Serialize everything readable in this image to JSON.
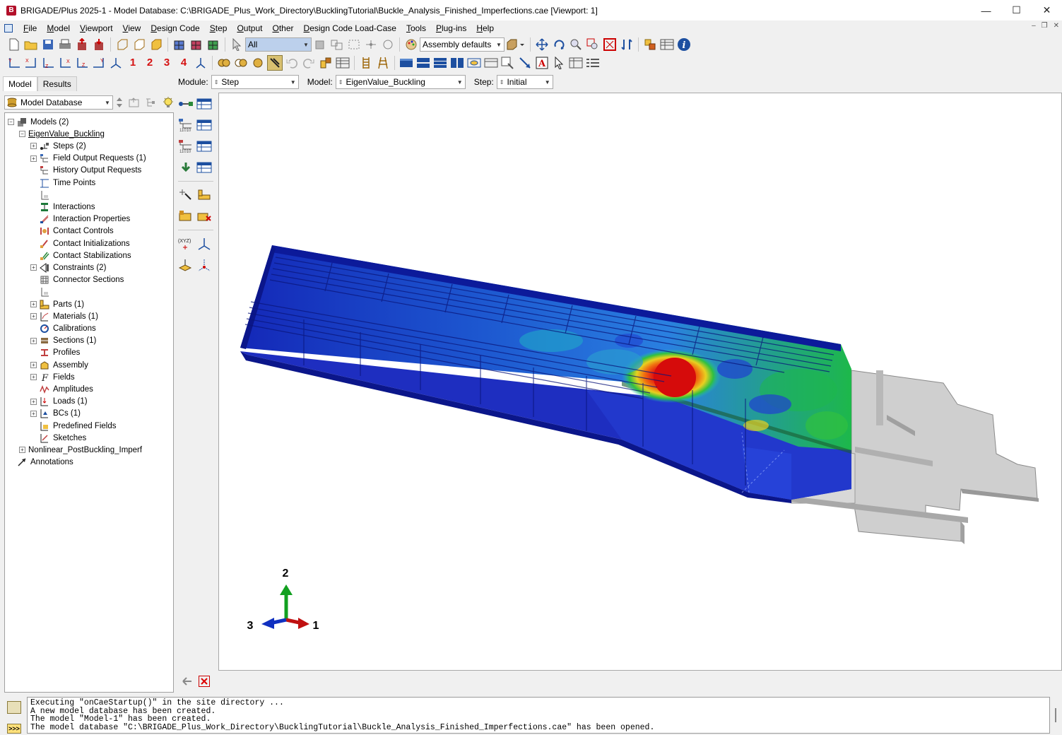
{
  "window": {
    "title": "BRIGADE/Plus 2025-1 - Model Database: C:\\BRIGADE_Plus_Work_Directory\\BucklingTutorial\\Buckle_Analysis_Finished_Imperfections.cae [Viewport: 1]",
    "app_icon_letter": "B"
  },
  "menu": [
    {
      "label": "File",
      "key": "F",
      "rest": "ile"
    },
    {
      "label": "Model",
      "key": "M",
      "rest": "odel"
    },
    {
      "label": "Viewport",
      "key": "V",
      "rest": "iewport"
    },
    {
      "label": "View",
      "key": "V",
      "rest": "iew"
    },
    {
      "label": "Design Code",
      "key": "D",
      "rest": "esign Code"
    },
    {
      "label": "Step",
      "key": "S",
      "rest": "tep"
    },
    {
      "label": "Output",
      "key": "O",
      "rest": "utput"
    },
    {
      "label": "Other",
      "key": "O",
      "rest": "ther"
    },
    {
      "label": "Design Code Load-Case",
      "key": "D",
      "rest": "esign Code Load-Case"
    },
    {
      "label": "Tools",
      "key": "T",
      "rest": "ools"
    },
    {
      "label": "Plug-ins",
      "key": "P",
      "rest": "lug-ins"
    },
    {
      "label": "Help",
      "key": "H",
      "rest": "elp"
    }
  ],
  "toolbar": {
    "selection_filter": "All",
    "render_style": "Assembly defaults",
    "view_numbers": [
      "1",
      "2",
      "3",
      "4"
    ]
  },
  "left_tabs": [
    "Model",
    "Results"
  ],
  "model_database_label": "Model Database",
  "tree": [
    {
      "label": "Models (2)",
      "indent": 0,
      "exp": "−",
      "icon": "models-icon"
    },
    {
      "label": "EigenValue_Buckling",
      "indent": 1,
      "exp": "−",
      "icon": "",
      "underline": true
    },
    {
      "label": "Steps (2)",
      "indent": 2,
      "exp": "+",
      "icon": "steps-icon"
    },
    {
      "label": "Field Output Requests (1)",
      "indent": 2,
      "exp": "+",
      "icon": "field-output-icon"
    },
    {
      "label": "History Output Requests",
      "indent": 2,
      "exp": "",
      "icon": "history-output-icon"
    },
    {
      "label": "Time Points",
      "indent": 2,
      "exp": "",
      "icon": "time-points-icon"
    },
    {
      "label": "",
      "indent": 2,
      "exp": "",
      "icon": "blank-item-icon"
    },
    {
      "label": "Interactions",
      "indent": 2,
      "exp": "",
      "icon": "interactions-icon"
    },
    {
      "label": "Interaction Properties",
      "indent": 2,
      "exp": "",
      "icon": "interaction-properties-icon"
    },
    {
      "label": "Contact Controls",
      "indent": 2,
      "exp": "",
      "icon": "contact-controls-icon"
    },
    {
      "label": "Contact Initializations",
      "indent": 2,
      "exp": "",
      "icon": "contact-initializations-icon"
    },
    {
      "label": "Contact Stabilizations",
      "indent": 2,
      "exp": "",
      "icon": "contact-stabilizations-icon"
    },
    {
      "label": "Constraints (2)",
      "indent": 2,
      "exp": "+",
      "icon": "constraints-icon"
    },
    {
      "label": "Connector Sections",
      "indent": 2,
      "exp": "",
      "icon": "connector-sections-icon"
    },
    {
      "label": "",
      "indent": 2,
      "exp": "",
      "icon": "blank-item-icon"
    },
    {
      "label": "Parts (1)",
      "indent": 2,
      "exp": "+",
      "icon": "parts-icon"
    },
    {
      "label": "Materials (1)",
      "indent": 2,
      "exp": "+",
      "icon": "materials-icon"
    },
    {
      "label": "Calibrations",
      "indent": 2,
      "exp": "",
      "icon": "calibrations-icon"
    },
    {
      "label": "Sections (1)",
      "indent": 2,
      "exp": "+",
      "icon": "sections-icon"
    },
    {
      "label": "Profiles",
      "indent": 2,
      "exp": "",
      "icon": "profiles-icon"
    },
    {
      "label": "Assembly",
      "indent": 2,
      "exp": "+",
      "icon": "assembly-icon"
    },
    {
      "label": "Fields",
      "indent": 2,
      "exp": "+",
      "icon": "fields-icon"
    },
    {
      "label": "Amplitudes",
      "indent": 2,
      "exp": "",
      "icon": "amplitudes-icon"
    },
    {
      "label": "Loads (1)",
      "indent": 2,
      "exp": "+",
      "icon": "loads-icon"
    },
    {
      "label": "BCs (1)",
      "indent": 2,
      "exp": "+",
      "icon": "bcs-icon"
    },
    {
      "label": "Predefined Fields",
      "indent": 2,
      "exp": "",
      "icon": "predefined-fields-icon"
    },
    {
      "label": "Sketches",
      "indent": 2,
      "exp": "",
      "icon": "sketches-icon"
    },
    {
      "label": "Nonlinear_PostBuckling_Imperf",
      "indent": 1,
      "exp": "+",
      "icon": ""
    },
    {
      "label": "Annotations",
      "indent": 0,
      "exp": "",
      "icon": "annotations-icon"
    }
  ],
  "context": {
    "module_label": "Module:",
    "module_value": "Step",
    "model_label": "Model:",
    "model_value": "EigenValue_Buckling",
    "step_label": "Step:",
    "step_value": "Initial"
  },
  "triad": {
    "axis_1": "1",
    "axis_2": "2",
    "axis_3": "3"
  },
  "messages": [
    "Executing \"onCaeStartup()\" in the site directory ...",
    "A new model database has been created.",
    "The model \"Model-1\" has been created.",
    "The model database \"C:\\BRIGADE_Plus_Work_Directory\\BucklingTutorial\\Buckle_Analysis_Finished_Imperfections.cae\" has been opened."
  ],
  "colors": {
    "contour_low": "#1530c8",
    "contour_mid": "#1db84a",
    "contour_high": "#e01010",
    "mesh_grey": "#cfcfcf"
  }
}
